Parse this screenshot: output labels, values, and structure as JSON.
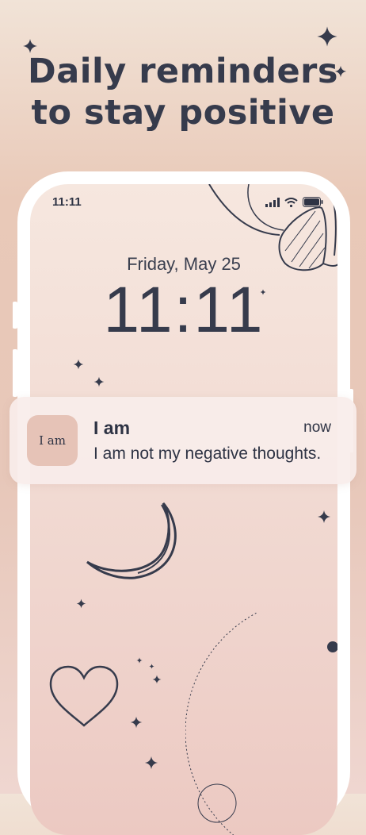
{
  "headline": {
    "line1": "Daily reminders",
    "line2": "to stay positive"
  },
  "colors": {
    "text_dark": "#363b4c",
    "app_icon_bg": "#e6c3b7",
    "phone_frame": "#ffffff"
  },
  "phone": {
    "status_bar": {
      "time": "11:11",
      "icons": [
        "cellular-signal-icon",
        "wifi-icon",
        "battery-icon"
      ]
    },
    "lock_screen": {
      "date": "Friday, May 25",
      "time": "11:11"
    },
    "decorations": [
      "sun-icon",
      "moon-icon",
      "heart-icon",
      "sparkle-icon",
      "orbit-circle"
    ]
  },
  "notification": {
    "app_icon_text": "I am",
    "app_name": "I am",
    "time": "now",
    "message": "I am not my negative thoughts."
  }
}
